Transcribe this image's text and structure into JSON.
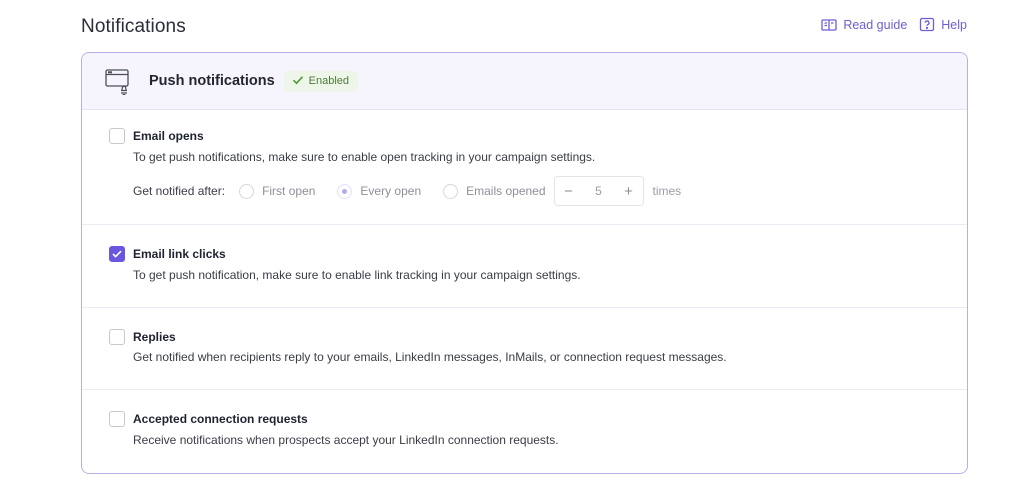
{
  "page": {
    "title": "Notifications"
  },
  "header_links": {
    "read_guide": "Read guide",
    "help": "Help"
  },
  "card": {
    "title": "Push notifications",
    "badge": "Enabled"
  },
  "sections": [
    {
      "title": "Email opens",
      "description": "To get push notifications, make sure to enable open tracking in your campaign settings.",
      "checked": false,
      "notify": {
        "label": "Get notified after:",
        "options": [
          "First open",
          "Every open",
          "Emails opened"
        ],
        "selected": "Every open",
        "count": "5",
        "minus": "−",
        "plus": "+",
        "suffix": "times"
      }
    },
    {
      "title": "Email link clicks",
      "description": "To get push notification, make sure to enable link tracking in your campaign settings.",
      "checked": true
    },
    {
      "title": "Replies",
      "description": "Get notified when recipients reply to your emails, LinkedIn messages, InMails, or connection request messages.",
      "checked": false
    },
    {
      "title": "Accepted connection requests",
      "description": "Receive notifications when prospects accept your LinkedIn connection requests.",
      "checked": false
    }
  ],
  "colors": {
    "accent": "#6a57e0",
    "border": "#b9aee8",
    "header_bg": "#f6f4fd",
    "badge_bg": "#eef6ea",
    "badge_text": "#4c7a3a"
  }
}
